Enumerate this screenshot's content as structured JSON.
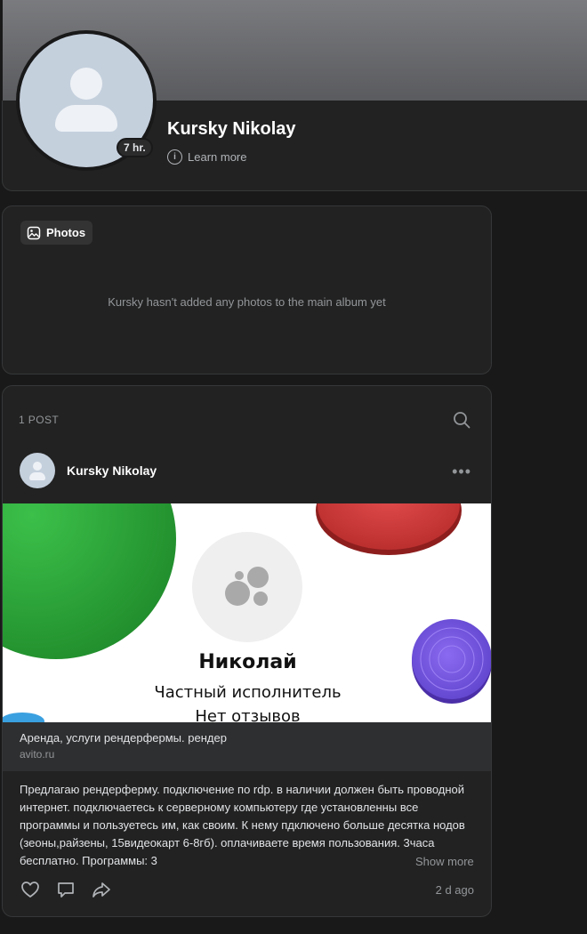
{
  "profile": {
    "name": "Kursky Nikolay",
    "online_badge": "7 hr.",
    "learn_more": "Learn more"
  },
  "photos": {
    "chip_label": "Photos",
    "empty_text": "Kursky hasn't added any photos to the main album yet"
  },
  "posts": {
    "count_label": "1 POST",
    "items": [
      {
        "author": "Kursky Nikolay",
        "link_image": {
          "name": "Николай",
          "role": "Частный исполнитель",
          "reviews": "Нет отзывов"
        },
        "link_title": "Аренда, услуги рендерфермы. рендер",
        "link_domain": "avito.ru",
        "text": "Предлагаю рендерферму. подключение по rdp. в наличии должен быть проводной интернет. подключаетесь к серверному компьютеру где установленны все программы и пользуетесь им, как своим. К нему пдключено больше десятка нодов (зеоны,райзены, 15видеокарт 6-8гб). оплачиваете время пользования. 3часа бесплатно. Программы: 3",
        "show_more": "Show more",
        "time": "2 d ago"
      }
    ]
  },
  "colors": {
    "background": "#19191a",
    "card": "#222222",
    "border": "#363738",
    "muted_text": "#939699",
    "avatar_placeholder": "#c5d0dd"
  }
}
